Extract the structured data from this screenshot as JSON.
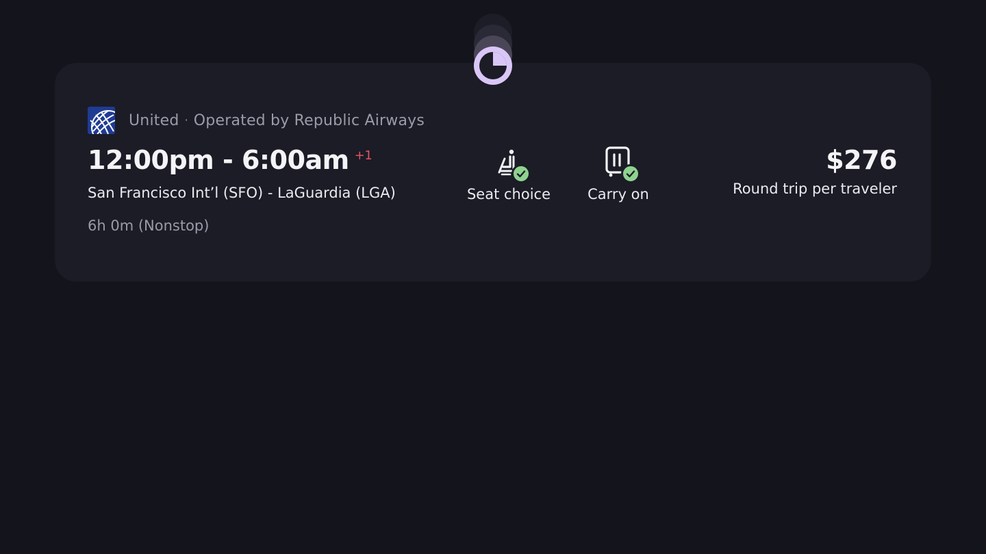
{
  "flight": {
    "airline": "United",
    "separator": "·",
    "operator": "Operated by Republic Airways",
    "times": "12:00pm - 6:00am",
    "day_offset": "+1",
    "route": "San Francisco Int’l (SFO) - LaGuardia (LGA)",
    "duration": "6h 0m (Nonstop)"
  },
  "amenities": [
    {
      "label": "Seat choice",
      "icon": "seat-icon",
      "included": true
    },
    {
      "label": "Carry on",
      "icon": "carry-on-bag-icon",
      "included": true
    }
  ],
  "price": {
    "amount": "$276",
    "note": "Round trip per traveler"
  },
  "colors": {
    "background": "#14141c",
    "card": "#1b1c26",
    "accent_moon": "#d9c6f7",
    "check": "#8fd28f",
    "day_offset": "#e2535f"
  }
}
